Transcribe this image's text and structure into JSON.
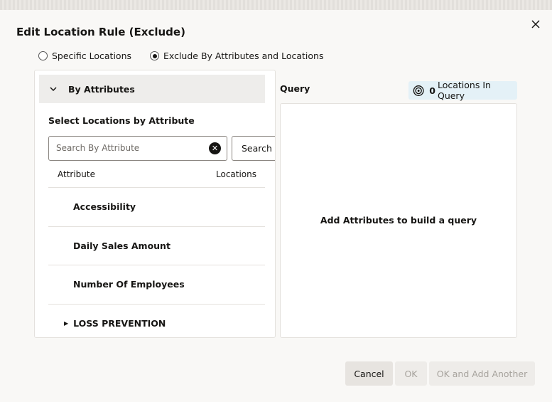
{
  "dialog": {
    "title": "Edit Location Rule (Exclude)",
    "close_icon": "close-icon"
  },
  "mode": {
    "options": [
      {
        "label": "Specific Locations",
        "selected": false
      },
      {
        "label": "Exclude By Attributes and Locations",
        "selected": true
      }
    ]
  },
  "attributes_panel": {
    "accordion_title": "By Attributes",
    "section_label": "Select Locations by Attribute",
    "search_placeholder": "Search By Attribute",
    "search_value": "",
    "search_button": "Search",
    "columns": {
      "attribute": "Attribute",
      "locations": "Locations"
    },
    "rows": [
      {
        "label": "Accessibility"
      },
      {
        "label": "Daily Sales Amount"
      },
      {
        "label": "Number Of Employees"
      }
    ],
    "group": {
      "label": "LOSS PREVENTION",
      "expanded": false
    }
  },
  "query": {
    "label": "Query",
    "count": "0",
    "count_suffix": "Locations In Query",
    "empty_message": "Add Attributes to build a query"
  },
  "footer": {
    "cancel": "Cancel",
    "ok": "OK",
    "ok_add_another": "OK and Add Another"
  },
  "colors": {
    "badge_bg": "#e4f1f7",
    "text": "#161513",
    "disabled_text": "#a7a39d"
  }
}
